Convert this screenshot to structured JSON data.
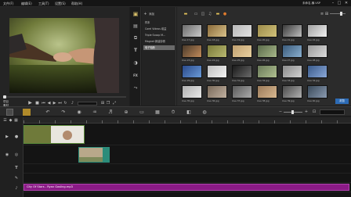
{
  "menu": {
    "items": [
      "文件(F)",
      "编辑(E)",
      "工具(T)",
      "设置(S)",
      "帮助(H)"
    ],
    "project_name": "未命名,横.VSP"
  },
  "window_controls": {
    "minimize": "–",
    "maximize": "□",
    "close": "✕"
  },
  "player": {
    "project_label": "项目",
    "clip_label": "素材"
  },
  "library": {
    "add_label": "添加",
    "folders": [
      "样本",
      "Corel Videos 增益",
      "Triple Scoop M...",
      "Magnet 新建剪辑",
      "电子相册"
    ],
    "selected_folder_index": 4,
    "thumbs": [
      {
        "label": "love 17.jpg"
      },
      {
        "label": "love 18.jpg"
      },
      {
        "label": "love 19.jpg"
      },
      {
        "label": "love 20.jpg"
      },
      {
        "label": "love 21.jpg"
      },
      {
        "label": "love 22.jpg"
      },
      {
        "label": "love 23.jpg"
      },
      {
        "label": "love 24.jpg"
      },
      {
        "label": "love 25.jpg"
      },
      {
        "label": "love 26.jpg"
      },
      {
        "label": "love 27.jpg"
      },
      {
        "label": "love 28.jpg"
      },
      {
        "label": "love 29.jpg"
      },
      {
        "label": "love 30.jpg"
      },
      {
        "label": "love 31.jpg"
      },
      {
        "label": "love 32.jpg"
      },
      {
        "label": "love 33.jpg"
      },
      {
        "label": "love 34.jpg"
      },
      {
        "label": "love 35.jpg"
      },
      {
        "label": "love 36.jpg"
      },
      {
        "label": "love 37.jpg"
      },
      {
        "label": "love 38.jpg"
      },
      {
        "label": "love 39.jpg"
      },
      {
        "label": "love 40.jpg"
      }
    ],
    "browse_label": "浏览"
  },
  "timeline": {
    "audio_clip_label": "City Of Stars - Ryan Gosling.mp3"
  },
  "colors": {
    "accent_blue": "#2d6bb5",
    "audio_purple": "#8a1a86",
    "clip_teal": "#2b8c7a"
  }
}
